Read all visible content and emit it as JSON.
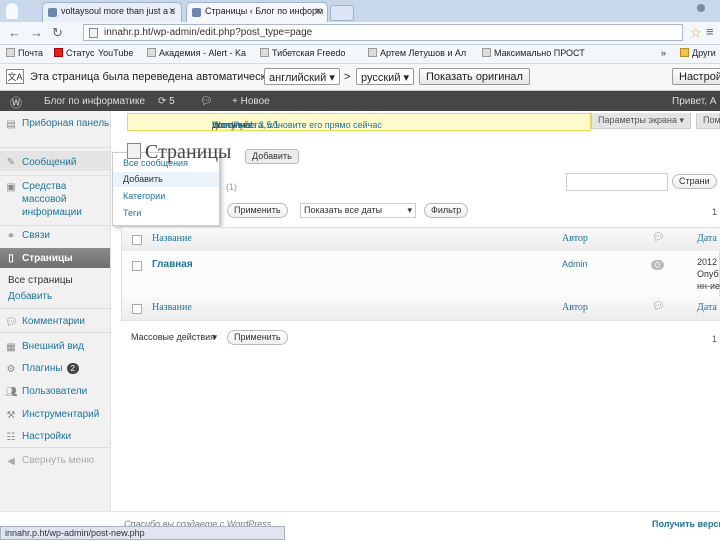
{
  "browser": {
    "tabs": [
      {
        "title": "voltaysoul more than just a s"
      },
      {
        "title": "Страницы ‹ Блог по информ"
      }
    ],
    "url": "innahr.p.ht/wp-admin/edit.php?post_type=page",
    "bookmarks": [
      "Почта",
      "Статус",
      "YouTube",
      "Академия - Alert - Ka",
      "Тибетская Freedo",
      "Артем Летушов и Ал",
      "Максимально ПРОСТ"
    ],
    "bookmarks_more": "»",
    "bookmarks_other": "Други",
    "status_url": "innahr.p.ht/wp-admin/post-new.php"
  },
  "translate_bar": {
    "message": "Эта страница была переведена автоматически",
    "from_lang": "английский",
    "arrow": ">",
    "to_lang": "русский",
    "show_original": "Показать оригинал",
    "settings": "Настрой"
  },
  "admin_bar": {
    "site_name": "Блог по информатике",
    "updates_count": "5",
    "new_label": "Новое",
    "greeting": "Привет, А"
  },
  "sidebar": {
    "dashboard": "Приборная панель",
    "posts": "Сообщений",
    "media": "Средства массовой информации",
    "links": "Связи",
    "pages": "Страницы",
    "pages_sub": [
      "Все страницы",
      "Добавить"
    ],
    "comments": "Комментарии",
    "appearance": "Внешний вид",
    "plugins": "Плагины",
    "plugins_count": "2",
    "users": "Пользователи",
    "tools": "Инструментарий",
    "settings": "Настройки",
    "collapse": "Свернуть меню"
  },
  "posts_flyout": [
    "Все сообщения",
    "Добавить",
    "Категории",
    "Теги"
  ],
  "main": {
    "notice_version": "WordPress 3.5.1",
    "notice_text": " доступно! ",
    "notice_link": "Пожалуйста, обновите его прямо сейчас",
    "notice_end": ".",
    "screen_options": "Параметры экрана",
    "help": "Помощь",
    "heading": "Страницы",
    "add_new": "Добавить",
    "count_text": "(1)",
    "search_button": "Страни",
    "apply": "Применить",
    "dates_filter": "Показать все даты",
    "filter_button": "Фильтр",
    "bulk_actions": "Массовые действия",
    "items_count": "1",
    "columns": [
      "Название",
      "Автор",
      "Дата"
    ],
    "row": {
      "title": "Главная",
      "author": "Admin",
      "comments": "0",
      "date_lines": [
        "2012",
        "Опуб",
        "нн-ие"
      ]
    },
    "footer_left": "Спасибо вы создаете с WordPress",
    "footer_right": "Получить верси"
  }
}
